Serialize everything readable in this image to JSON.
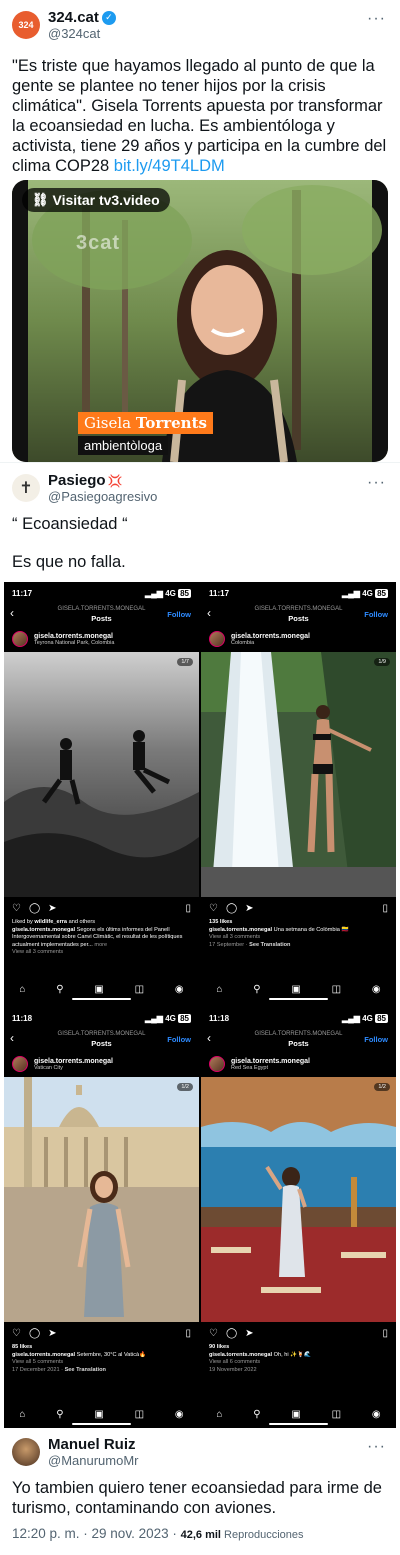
{
  "tweet1": {
    "name": "324.cat",
    "handle": "@324cat",
    "avatar_text": "324",
    "text_main": "\"Es triste que hayamos llegado al punto de que la gente se plantee no tener hijos por la crisis climática\". Gisela Torrents apuesta por transformar la ecoansiedad en lucha. Es ambientóloga y activista, tiene 29 años y participa en la cumbre del clima COP28 ",
    "link": "bit.ly/49T4LDM",
    "video_button": "Visitar tv3.video",
    "watermark": "3cat",
    "caption_first": "Gisela",
    "caption_last": "Torrents",
    "caption_role": "ambientòloga"
  },
  "tweet2": {
    "name": "Pasiego",
    "emoji": "💢",
    "handle": "@Pasiegoagresivo",
    "line1": "“ Ecoansiedad “",
    "line2": "Es que no falla."
  },
  "ig_posts": [
    {
      "time": "11:17",
      "net": "4G",
      "battery": "85",
      "account": "GISELA.TORRENTS.MONEGAL",
      "title": "Posts",
      "follow": "Follow",
      "username": "gisela.torrents.monegal",
      "location": "Teyrona National Park, Colombia",
      "page": "1/7",
      "likes_pre": "Liked by ",
      "likes_user": "wildlife_erra",
      "likes_post": " and others",
      "cap_user": "gisela.torrents.monegal",
      "cap_text": " Segons els últims informes del Panell Intergovernamental sobre Canvi Climàtic, el resultat de les polítiques actualment implementades per... ",
      "cap_more": "more",
      "comments": "View all 3 comments",
      "date": ""
    },
    {
      "time": "11:17",
      "net": "4G",
      "battery": "85",
      "account": "GISELA.TORRENTS.MONEGAL",
      "title": "Posts",
      "follow": "Follow",
      "username": "gisela.torrents.monegal",
      "location": "Colombia",
      "page": "1/9",
      "likes_pre": "135 likes",
      "likes_user": "",
      "likes_post": "",
      "cap_user": "gisela.torrents.monegal",
      "cap_text": " Una setmana de Colòmbia 🇨🇴",
      "cap_more": "",
      "comments": "View all 3 comments",
      "date": "17 September · ",
      "see": "See Translation"
    },
    {
      "time": "11:18",
      "net": "4G",
      "battery": "85",
      "account": "GISELA.TORRENTS.MONEGAL",
      "title": "Posts",
      "follow": "Follow",
      "username": "gisela.torrents.monegal",
      "location": "Vatican City",
      "page": "1/2",
      "likes_pre": "85 likes",
      "likes_user": "",
      "likes_post": "",
      "cap_user": "gisela.torrents.monegal",
      "cap_text": " Setembre, 30°C al Vaticà🔥",
      "cap_more": "",
      "comments": "View all 5 comments",
      "date": "17 December 2021 · ",
      "see": "See Translation"
    },
    {
      "time": "11:18",
      "net": "4G",
      "battery": "85",
      "account": "GISELA.TORRENTS.MONEGAL",
      "title": "Posts",
      "follow": "Follow",
      "username": "gisela.torrents.monegal",
      "location": "Red Sea Egypt",
      "page": "1/2",
      "likes_pre": "90 likes",
      "likes_user": "",
      "likes_post": "",
      "cap_user": "gisela.torrents.monegal",
      "cap_text": " Oh, hi ✨🍹🌊",
      "cap_more": "",
      "comments": "View all 6 comments",
      "date": "19 November 2022",
      "see": ""
    }
  ],
  "tweet3": {
    "name": "Manuel Ruiz",
    "handle": "@ManurumoMr",
    "text": "Yo tambien quiero tener ecoansiedad para irme de turismo, contaminando con aviones.",
    "time": "12:20 p. m. · 29 nov. 2023 · ",
    "views_count": "42,6 mil",
    "views_label": " Reproducciones"
  },
  "colors": {
    "link": "#1d9bf0",
    "verified": "#1d9bf0",
    "caption_bg": "#ff7a1a"
  },
  "icons": [
    "verified-badge-icon",
    "link-icon",
    "back-arrow-icon",
    "heart-icon",
    "comment-icon",
    "share-icon",
    "bookmark-icon",
    "home-icon",
    "search-icon",
    "reels-icon",
    "shop-icon",
    "profile-icon"
  ]
}
